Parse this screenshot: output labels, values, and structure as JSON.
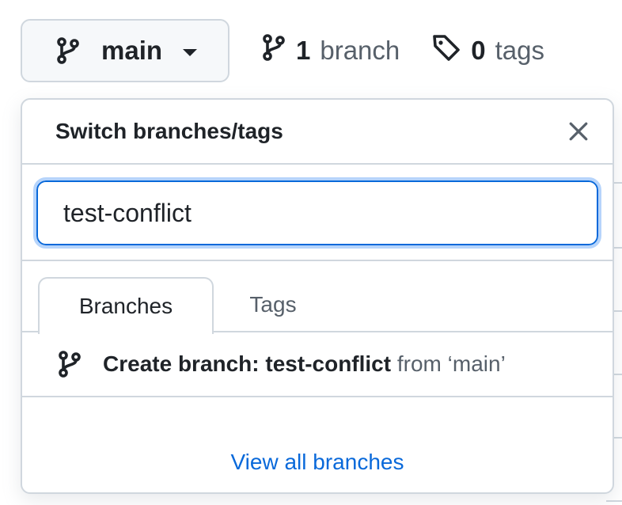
{
  "branch_selector": {
    "current_branch": "main",
    "icon": "git-branch-icon"
  },
  "stats": {
    "branches_count": "1",
    "branches_label": "branch",
    "tags_count": "0",
    "tags_label": "tags"
  },
  "popover": {
    "title": "Switch branches/tags",
    "filter_value": "test-conflict",
    "tabs": [
      {
        "label": "Branches",
        "active": true
      },
      {
        "label": "Tags",
        "active": false
      }
    ],
    "create_prefix": "Create branch: ",
    "create_branch_name": "test-conflict",
    "create_from": "from ‘main’",
    "view_all_label": "View all branches"
  },
  "colors": {
    "accent": "#0969da",
    "border": "#d0d7de",
    "text": "#1f2328",
    "muted": "#57606a"
  }
}
